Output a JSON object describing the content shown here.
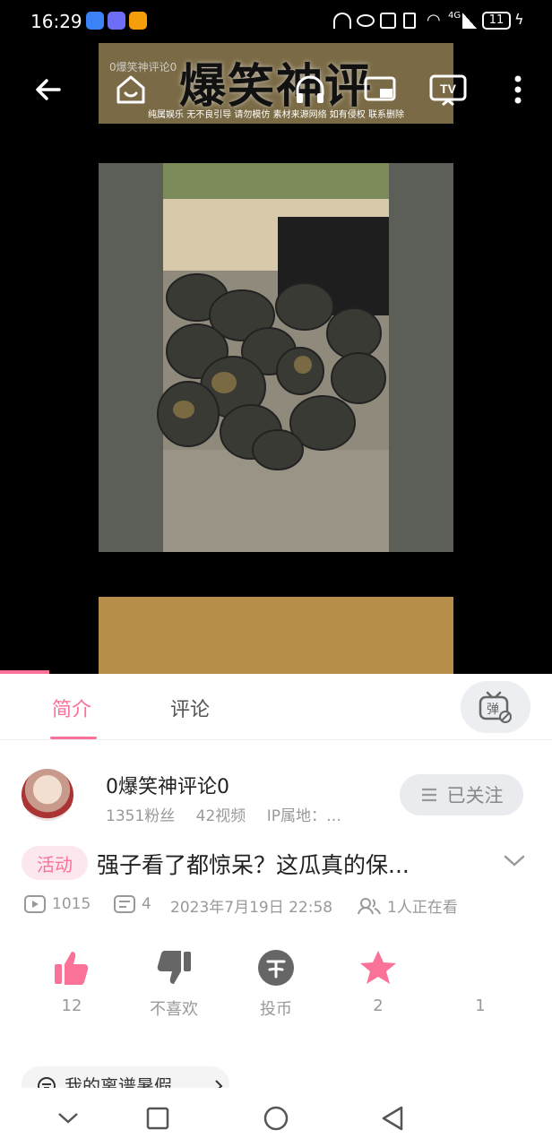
{
  "status_bar": {
    "time": "16:29",
    "signal": "4G",
    "battery": "11"
  },
  "player": {
    "small_title": "0爆笑神评论0",
    "overlay_title": "爆笑神评",
    "disclaimer": "纯属娱乐 无不良引导 请勿模仿 素材来源网络 如有侵权 联系删除",
    "progress": 0.09
  },
  "tabs": {
    "intro": "简介",
    "comments": "评论",
    "danmu_icon_text": "弹"
  },
  "uploader": {
    "name": "0爆笑神评论0",
    "fans": "1351粉丝",
    "videos": "42视频",
    "ip": "IP属地：…",
    "follow_label": "已关注"
  },
  "video": {
    "badge": "活动",
    "title": "强子看了都惊呆？这瓜真的保...",
    "views": "1015",
    "danmaku": "4",
    "date": "2023年7月19日 22:58",
    "watching": "1人正在看"
  },
  "actions": {
    "like": "12",
    "dislike": "不喜欢",
    "coin": "投币",
    "favorite": "2",
    "share": "1"
  },
  "extra": {
    "label": "我的离谱暑假"
  },
  "colors": {
    "accent": "#fb7299",
    "gray": "#999999"
  }
}
